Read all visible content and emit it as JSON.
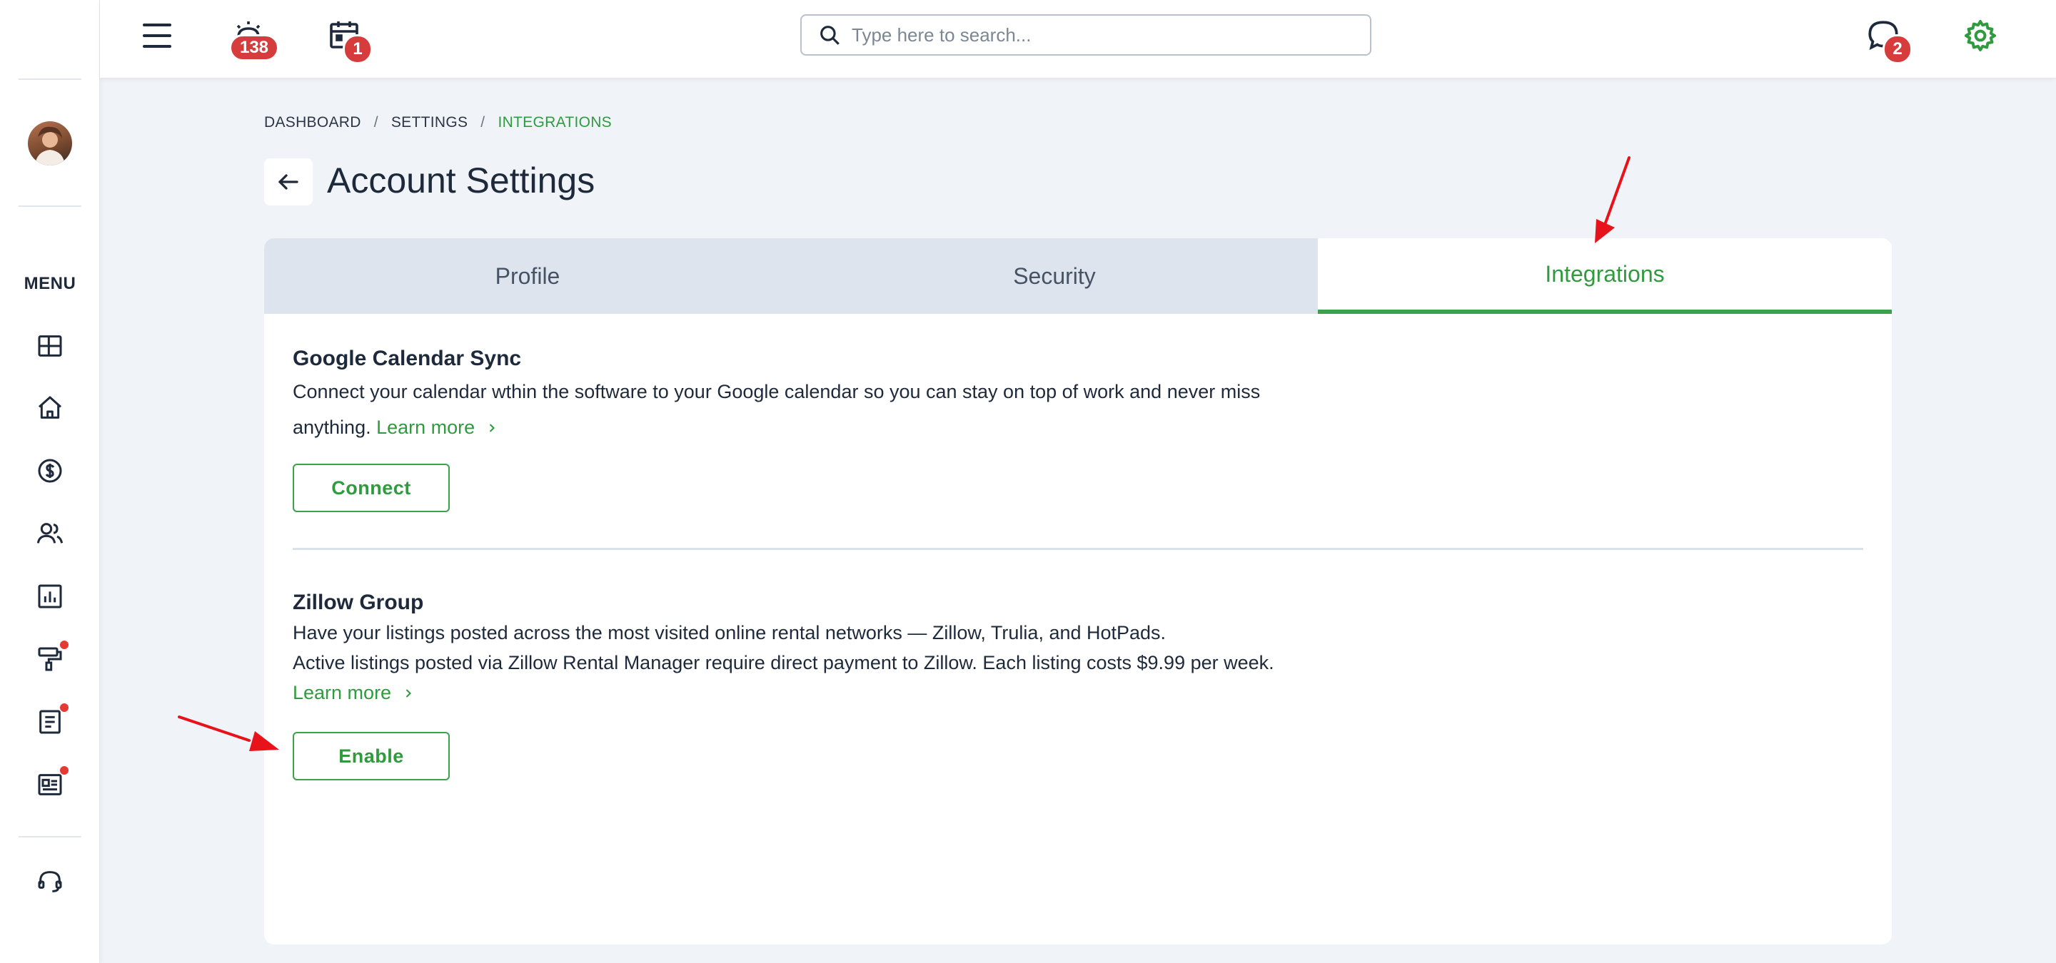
{
  "topbar": {
    "alerts_count": "138",
    "calendar_count": "1",
    "messages_count": "2",
    "search_placeholder": "Type here to search..."
  },
  "sidebar": {
    "menu_label": "MENU",
    "items": [
      {
        "icon": "dashboard-icon",
        "name": "Dashboard"
      },
      {
        "icon": "home-icon",
        "name": "Properties"
      },
      {
        "icon": "dollar-icon",
        "name": "Accounting"
      },
      {
        "icon": "people-icon",
        "name": "People"
      },
      {
        "icon": "reports-icon",
        "name": "Reports"
      },
      {
        "icon": "paint-roller-icon",
        "name": "Maintenance",
        "notification": true
      },
      {
        "icon": "document-icon",
        "name": "Documents",
        "notification": true
      },
      {
        "icon": "listing-icon",
        "name": "Listings",
        "notification": true
      },
      {
        "icon": "support-headset-icon",
        "name": "Support"
      }
    ]
  },
  "breadcrumb": {
    "items": [
      "DASHBOARD",
      "SETTINGS",
      "INTEGRATIONS"
    ],
    "separator": "/"
  },
  "page": {
    "title": "Account Settings"
  },
  "tabs": [
    {
      "label": "Profile",
      "active": false
    },
    {
      "label": "Security",
      "active": false
    },
    {
      "label": "Integrations",
      "active": true
    }
  ],
  "integrations": {
    "google": {
      "title": "Google Calendar Sync",
      "text_line1": "Connect your calendar wthin the software to your Google calendar so you can stay on top of work and never miss",
      "text_line2": "anything.",
      "learn_more": "Learn more",
      "button": "Connect"
    },
    "zillow": {
      "title": "Zillow Group",
      "text_line1": "Have your listings posted across the most visited online rental networks — Zillow, Trulia, and HotPads.",
      "text_line2": "Active listings posted via Zillow Rental Manager require direct payment to Zillow. Each listing costs $9.99 per week.",
      "learn_more": "Learn more",
      "button": "Enable"
    }
  },
  "colors": {
    "accent_green": "#2f9b3e",
    "badge_red": "#d63c3c",
    "annotation_red": "#e8121b",
    "tab_inactive_bg": "#dde4ee",
    "page_bg": "#f0f3f8"
  }
}
